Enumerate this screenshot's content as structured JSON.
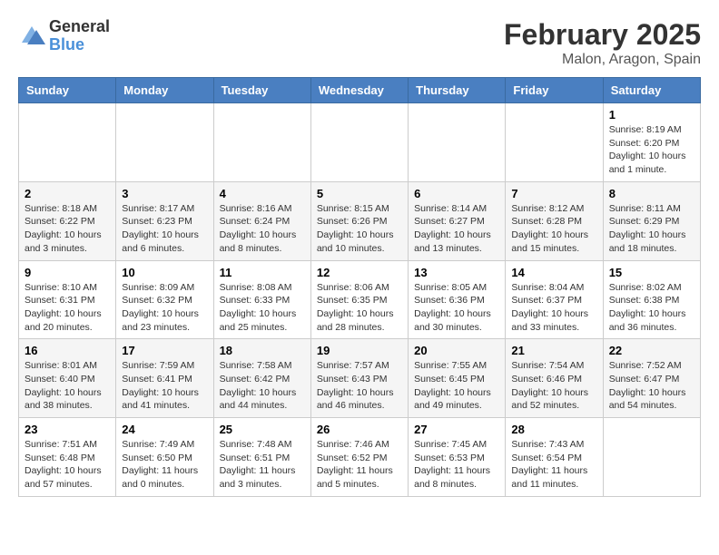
{
  "header": {
    "logo_general": "General",
    "logo_blue": "Blue",
    "title": "February 2025",
    "subtitle": "Malon, Aragon, Spain"
  },
  "weekdays": [
    "Sunday",
    "Monday",
    "Tuesday",
    "Wednesday",
    "Thursday",
    "Friday",
    "Saturday"
  ],
  "weeks": [
    [
      {
        "day": "",
        "info": ""
      },
      {
        "day": "",
        "info": ""
      },
      {
        "day": "",
        "info": ""
      },
      {
        "day": "",
        "info": ""
      },
      {
        "day": "",
        "info": ""
      },
      {
        "day": "",
        "info": ""
      },
      {
        "day": "1",
        "info": "Sunrise: 8:19 AM\nSunset: 6:20 PM\nDaylight: 10 hours and 1 minute."
      }
    ],
    [
      {
        "day": "2",
        "info": "Sunrise: 8:18 AM\nSunset: 6:22 PM\nDaylight: 10 hours and 3 minutes."
      },
      {
        "day": "3",
        "info": "Sunrise: 8:17 AM\nSunset: 6:23 PM\nDaylight: 10 hours and 6 minutes."
      },
      {
        "day": "4",
        "info": "Sunrise: 8:16 AM\nSunset: 6:24 PM\nDaylight: 10 hours and 8 minutes."
      },
      {
        "day": "5",
        "info": "Sunrise: 8:15 AM\nSunset: 6:26 PM\nDaylight: 10 hours and 10 minutes."
      },
      {
        "day": "6",
        "info": "Sunrise: 8:14 AM\nSunset: 6:27 PM\nDaylight: 10 hours and 13 minutes."
      },
      {
        "day": "7",
        "info": "Sunrise: 8:12 AM\nSunset: 6:28 PM\nDaylight: 10 hours and 15 minutes."
      },
      {
        "day": "8",
        "info": "Sunrise: 8:11 AM\nSunset: 6:29 PM\nDaylight: 10 hours and 18 minutes."
      }
    ],
    [
      {
        "day": "9",
        "info": "Sunrise: 8:10 AM\nSunset: 6:31 PM\nDaylight: 10 hours and 20 minutes."
      },
      {
        "day": "10",
        "info": "Sunrise: 8:09 AM\nSunset: 6:32 PM\nDaylight: 10 hours and 23 minutes."
      },
      {
        "day": "11",
        "info": "Sunrise: 8:08 AM\nSunset: 6:33 PM\nDaylight: 10 hours and 25 minutes."
      },
      {
        "day": "12",
        "info": "Sunrise: 8:06 AM\nSunset: 6:35 PM\nDaylight: 10 hours and 28 minutes."
      },
      {
        "day": "13",
        "info": "Sunrise: 8:05 AM\nSunset: 6:36 PM\nDaylight: 10 hours and 30 minutes."
      },
      {
        "day": "14",
        "info": "Sunrise: 8:04 AM\nSunset: 6:37 PM\nDaylight: 10 hours and 33 minutes."
      },
      {
        "day": "15",
        "info": "Sunrise: 8:02 AM\nSunset: 6:38 PM\nDaylight: 10 hours and 36 minutes."
      }
    ],
    [
      {
        "day": "16",
        "info": "Sunrise: 8:01 AM\nSunset: 6:40 PM\nDaylight: 10 hours and 38 minutes."
      },
      {
        "day": "17",
        "info": "Sunrise: 7:59 AM\nSunset: 6:41 PM\nDaylight: 10 hours and 41 minutes."
      },
      {
        "day": "18",
        "info": "Sunrise: 7:58 AM\nSunset: 6:42 PM\nDaylight: 10 hours and 44 minutes."
      },
      {
        "day": "19",
        "info": "Sunrise: 7:57 AM\nSunset: 6:43 PM\nDaylight: 10 hours and 46 minutes."
      },
      {
        "day": "20",
        "info": "Sunrise: 7:55 AM\nSunset: 6:45 PM\nDaylight: 10 hours and 49 minutes."
      },
      {
        "day": "21",
        "info": "Sunrise: 7:54 AM\nSunset: 6:46 PM\nDaylight: 10 hours and 52 minutes."
      },
      {
        "day": "22",
        "info": "Sunrise: 7:52 AM\nSunset: 6:47 PM\nDaylight: 10 hours and 54 minutes."
      }
    ],
    [
      {
        "day": "23",
        "info": "Sunrise: 7:51 AM\nSunset: 6:48 PM\nDaylight: 10 hours and 57 minutes."
      },
      {
        "day": "24",
        "info": "Sunrise: 7:49 AM\nSunset: 6:50 PM\nDaylight: 11 hours and 0 minutes."
      },
      {
        "day": "25",
        "info": "Sunrise: 7:48 AM\nSunset: 6:51 PM\nDaylight: 11 hours and 3 minutes."
      },
      {
        "day": "26",
        "info": "Sunrise: 7:46 AM\nSunset: 6:52 PM\nDaylight: 11 hours and 5 minutes."
      },
      {
        "day": "27",
        "info": "Sunrise: 7:45 AM\nSunset: 6:53 PM\nDaylight: 11 hours and 8 minutes."
      },
      {
        "day": "28",
        "info": "Sunrise: 7:43 AM\nSunset: 6:54 PM\nDaylight: 11 hours and 11 minutes."
      },
      {
        "day": "",
        "info": ""
      }
    ]
  ]
}
